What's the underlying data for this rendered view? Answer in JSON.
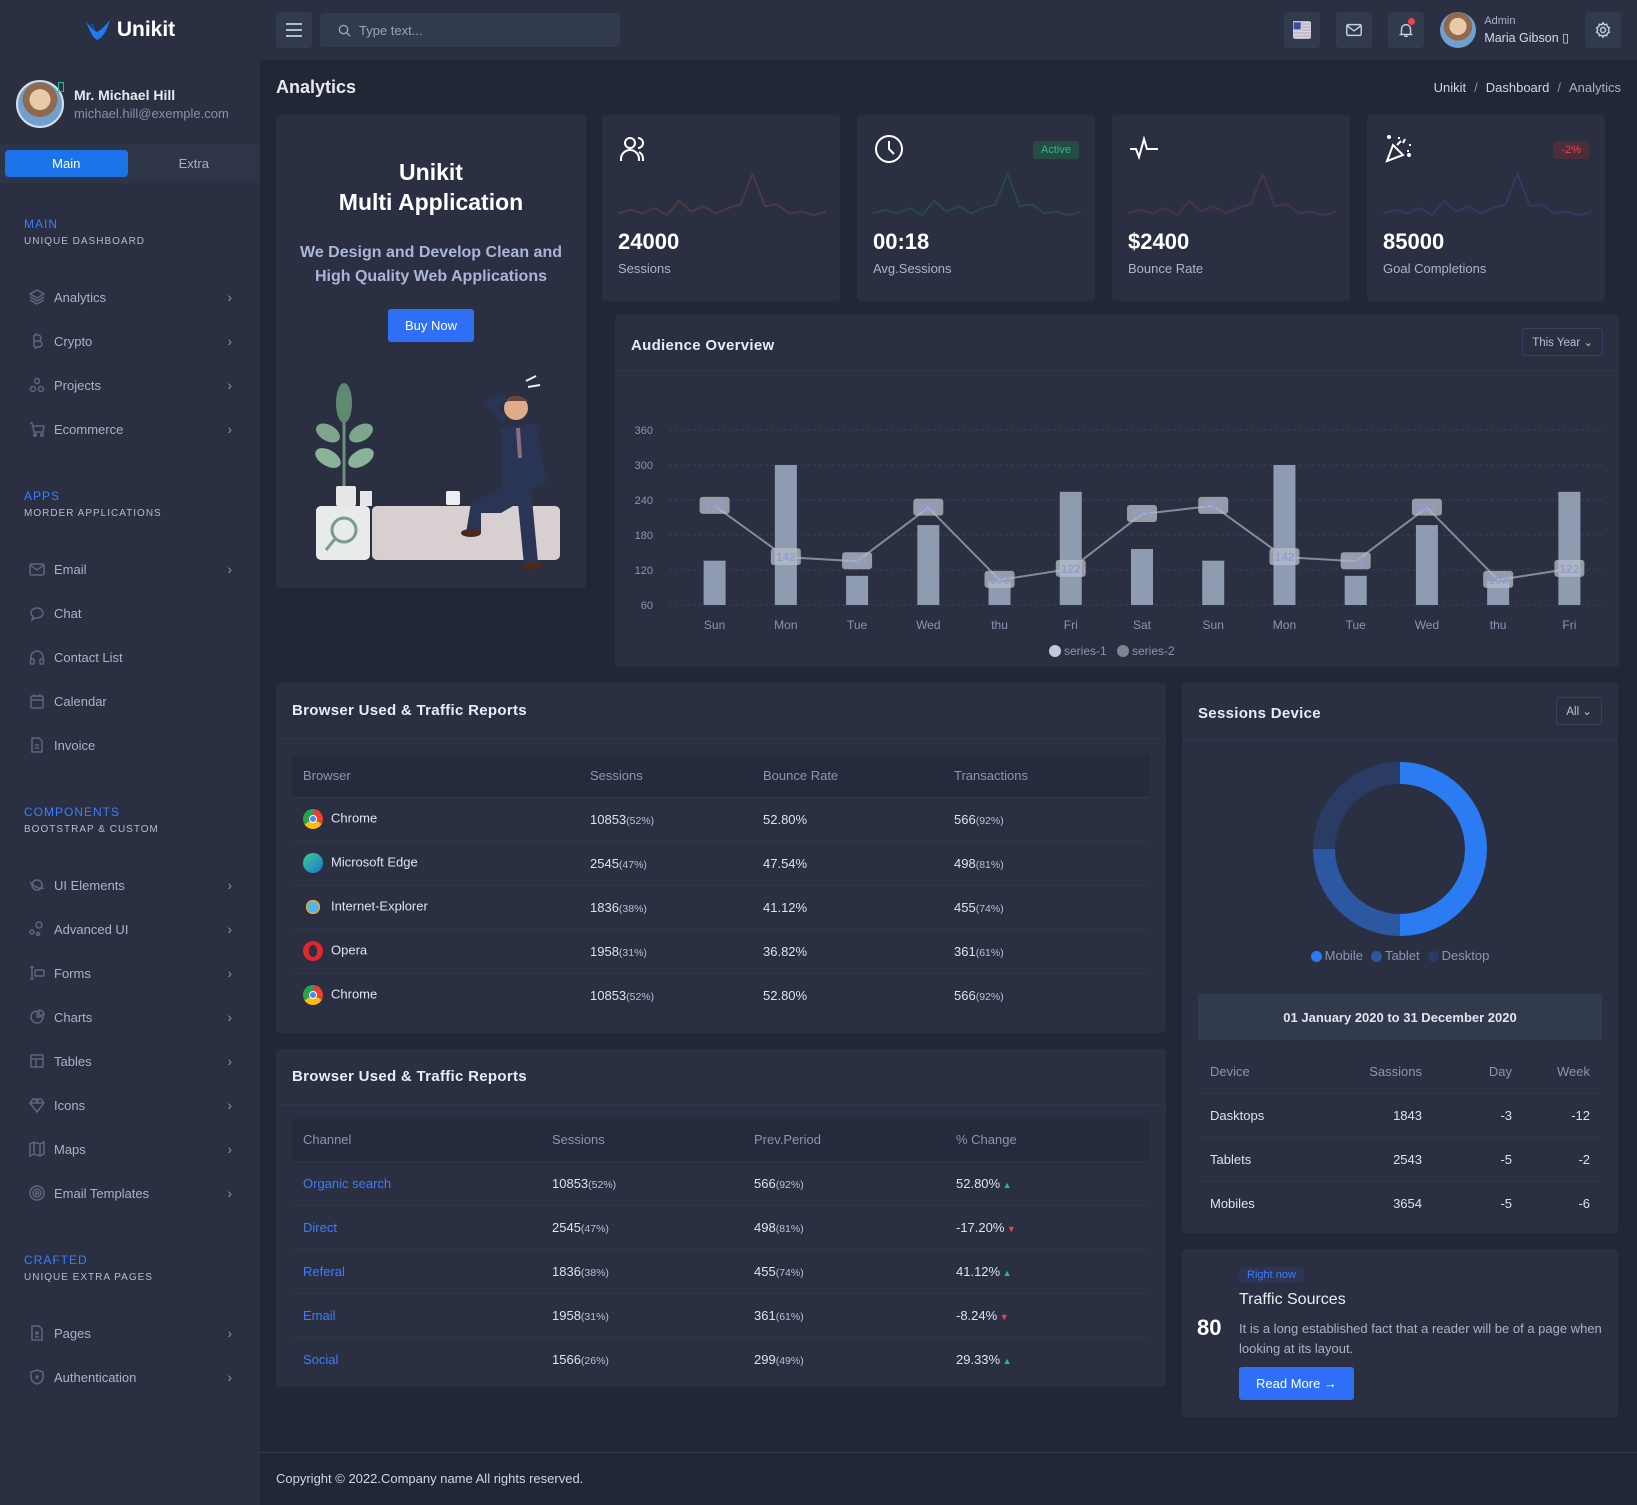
{
  "brand": {
    "name": "Unikit"
  },
  "profile": {
    "name": "Mr. Michael Hill",
    "email": "michael.hill@exemple.com"
  },
  "sidebar_tabs": [
    {
      "label": "Main"
    },
    {
      "label": "Extra"
    }
  ],
  "sidebar": {
    "sections": [
      {
        "title": "MAIN",
        "subtitle": "UNIQUE DASHBOARD",
        "items": [
          {
            "label": "Analytics",
            "icon": "layers-icon",
            "chevron": true
          },
          {
            "label": "Crypto",
            "icon": "bitcoin-icon",
            "chevron": true
          },
          {
            "label": "Projects",
            "icon": "circles-icon",
            "chevron": true
          },
          {
            "label": "Ecommerce",
            "icon": "cart-icon",
            "chevron": true
          }
        ]
      },
      {
        "title": "APPS",
        "subtitle": "MORDER APPLICATIONS",
        "items": [
          {
            "label": "Email",
            "icon": "mail-icon",
            "chevron": true
          },
          {
            "label": "Chat",
            "icon": "chat-icon",
            "chevron": false
          },
          {
            "label": "Contact List",
            "icon": "headphones-icon",
            "chevron": false
          },
          {
            "label": "Calendar",
            "icon": "calendar-icon",
            "chevron": false
          },
          {
            "label": "Invoice",
            "icon": "file-icon",
            "chevron": false
          }
        ]
      },
      {
        "title": "COMPONENTS",
        "subtitle": "BOOTSTRAP & CUSTOM",
        "items": [
          {
            "label": "UI Elements",
            "icon": "planet-icon",
            "chevron": true
          },
          {
            "label": "Advanced UI",
            "icon": "bubbles-icon",
            "chevron": true
          },
          {
            "label": "Forms",
            "icon": "forms-icon",
            "chevron": true
          },
          {
            "label": "Charts",
            "icon": "chart-pie-icon",
            "chevron": true
          },
          {
            "label": "Tables",
            "icon": "table-icon",
            "chevron": true
          },
          {
            "label": "Icons",
            "icon": "diamond-icon",
            "chevron": true
          },
          {
            "label": "Maps",
            "icon": "map-icon",
            "chevron": true
          },
          {
            "label": "Email Templates",
            "icon": "target-icon",
            "chevron": true
          }
        ]
      },
      {
        "title": "CRAFTED",
        "subtitle": "UNIQUE EXTRA PAGES",
        "items": [
          {
            "label": "Pages",
            "icon": "page-icon",
            "chevron": true
          },
          {
            "label": "Authentication",
            "icon": "shield-icon",
            "chevron": true
          }
        ]
      }
    ]
  },
  "topbar": {
    "search_placeholder": "Type text...",
    "user_role": "Admin",
    "user_name": "Maria Gibson ▯"
  },
  "page": {
    "title": "Analytics",
    "breadcrumb": [
      "Unikit",
      "Dashboard",
      "Analytics"
    ]
  },
  "promo": {
    "title_line1": "Unikit",
    "title_line2": "Multi Application",
    "text": "We Design and Develop Clean and High Quality Web Applications",
    "button": "Buy Now"
  },
  "stats": [
    {
      "value": "24000",
      "label": "Sessions",
      "icon": "users-icon",
      "badge": "",
      "spark_color": "#4a3a44"
    },
    {
      "value": "00:18",
      "label": "Avg.Sessions",
      "icon": "clock-icon",
      "badge": "Active",
      "badge_color": "#1ec08a",
      "badge_bg": "#264a44",
      "spark_color": "#27484c"
    },
    {
      "value": "$2400",
      "label": "Bounce Rate",
      "icon": "activity-icon",
      "badge": "",
      "spark_color": "#453450"
    },
    {
      "value": "85000",
      "label": "Goal Completions",
      "icon": "party-icon",
      "badge": "-2%",
      "badge_color": "#f0424d",
      "badge_bg": "#4a2e3a",
      "spark_color": "#2c3c62"
    }
  ],
  "audience": {
    "title": "Audience Overview",
    "filter": "This Year"
  },
  "chart_data": {
    "type": "bar",
    "title": "Audience Overview",
    "categories": [
      "Sun",
      "Mon",
      "Tue",
      "Wed",
      "thu",
      "Fri",
      "Sat",
      "Sun",
      "Mon",
      "Tue",
      "Wed",
      "thu",
      "Fri"
    ],
    "series": [
      {
        "name": "series-1",
        "type": "bar",
        "values": [
          136,
          300,
          110,
          197,
          100,
          254,
          156,
          136,
          300,
          110,
          197,
          100,
          254
        ]
      },
      {
        "name": "series-2",
        "type": "line",
        "values": [
          230,
          142,
          135,
          227,
          103,
          122,
          216,
          230,
          142,
          135,
          227,
          103,
          122
        ]
      }
    ],
    "yticks": [
      60,
      120,
      180,
      240,
      300,
      360
    ],
    "ylim": [
      60,
      360
    ],
    "grid": true,
    "legend": "bottom-center"
  },
  "browser_table": {
    "title": "Browser Used & Traffic Reports",
    "headers": [
      "Browser",
      "Sessions",
      "Bounce Rate",
      "Transactions"
    ],
    "rows": [
      {
        "browser": "Chrome",
        "icon": "chrome-icon",
        "sessions": "10853",
        "sessions_pct": "(52%)",
        "bounce": "52.80%",
        "trans": "566",
        "trans_pct": "(92%)"
      },
      {
        "browser": "Microsoft Edge",
        "icon": "edge-icon",
        "sessions": "2545",
        "sessions_pct": "(47%)",
        "bounce": "47.54%",
        "trans": "498",
        "trans_pct": "(81%)"
      },
      {
        "browser": "Internet-Explorer",
        "icon": "ie-icon",
        "sessions": "1836",
        "sessions_pct": "(38%)",
        "bounce": "41.12%",
        "trans": "455",
        "trans_pct": "(74%)"
      },
      {
        "browser": "Opera",
        "icon": "opera-icon",
        "sessions": "1958",
        "sessions_pct": "(31%)",
        "bounce": "36.82%",
        "trans": "361",
        "trans_pct": "(61%)"
      },
      {
        "browser": "Chrome",
        "icon": "chrome-icon",
        "sessions": "10853",
        "sessions_pct": "(52%)",
        "bounce": "52.80%",
        "trans": "566",
        "trans_pct": "(92%)"
      }
    ]
  },
  "channel_table": {
    "title": "Browser Used & Traffic Reports",
    "headers": [
      "Channel",
      "Sessions",
      "Prev.Period",
      "% Change"
    ],
    "rows": [
      {
        "channel": "Organic search",
        "sessions": "10853",
        "sessions_pct": "(52%)",
        "prev": "566",
        "prev_pct": "(92%)",
        "change": "52.80%",
        "dir": "up"
      },
      {
        "channel": "Direct",
        "sessions": "2545",
        "sessions_pct": "(47%)",
        "prev": "498",
        "prev_pct": "(81%)",
        "change": "-17.20%",
        "dir": "down"
      },
      {
        "channel": "Referal",
        "sessions": "1836",
        "sessions_pct": "(38%)",
        "prev": "455",
        "prev_pct": "(74%)",
        "change": "41.12%",
        "dir": "up"
      },
      {
        "channel": "Email",
        "sessions": "1958",
        "sessions_pct": "(31%)",
        "prev": "361",
        "prev_pct": "(61%)",
        "change": "-8.24%",
        "dir": "down"
      },
      {
        "channel": "Social",
        "sessions": "1566",
        "sessions_pct": "(26%)",
        "prev": "299",
        "prev_pct": "(49%)",
        "change": "29.33%",
        "dir": "up"
      }
    ]
  },
  "sessions_device": {
    "title": "Sessions Device",
    "filter": "All",
    "donut": [
      {
        "label": "Mobile",
        "value": 50,
        "color": "#2b7bf3"
      },
      {
        "label": "Tablet",
        "value": 25,
        "color": "#2b58a0"
      },
      {
        "label": "Desktop",
        "value": 25,
        "color": "#2a3c64"
      }
    ],
    "date_range": "01 January 2020 to 31 December 2020",
    "headers": [
      "Device",
      "Sassions",
      "Day",
      "Week"
    ],
    "rows": [
      {
        "device": "Dasktops",
        "sessions": "1843",
        "day": "-3",
        "week": "-12"
      },
      {
        "device": "Tablets",
        "sessions": "2543",
        "day": "-5",
        "week": "-2"
      },
      {
        "device": "Mobiles",
        "sessions": "3654",
        "day": "-5",
        "week": "-6"
      }
    ]
  },
  "traffic": {
    "number": "80",
    "badge": "Right now",
    "title": "Traffic Sources",
    "text": "It is a long established fact that a reader will be of a page when looking at its layout.",
    "button": "Read More →"
  },
  "footer": {
    "text": "Copyright © 2022.Company name All rights reserved."
  }
}
